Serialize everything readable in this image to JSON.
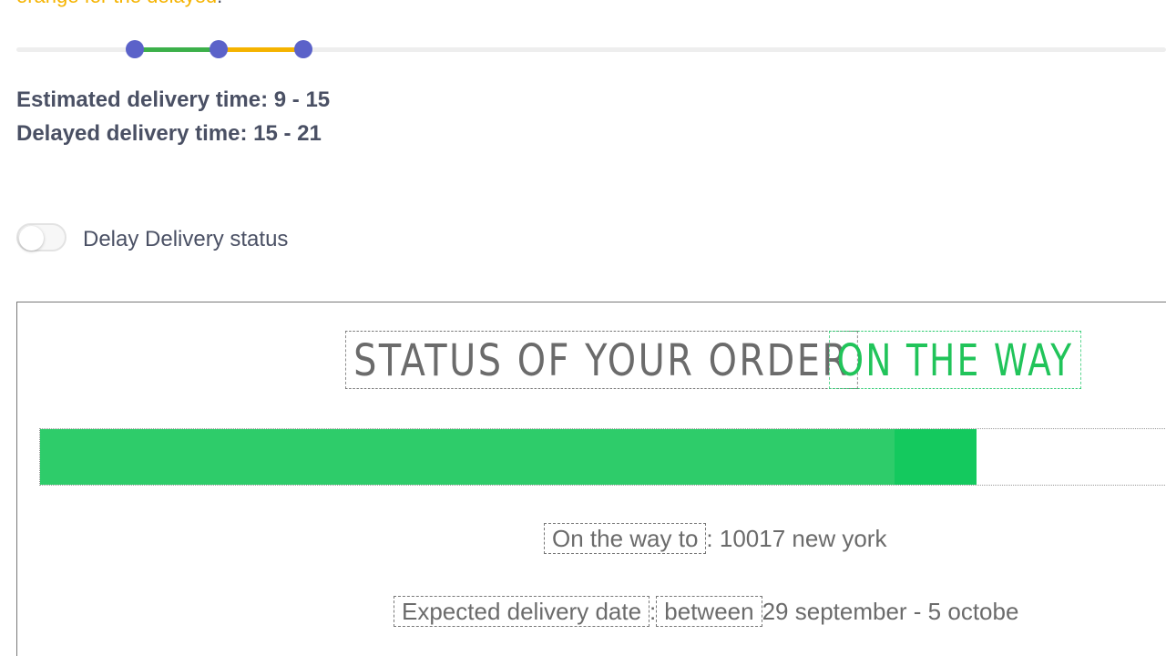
{
  "intro": {
    "orange_text": "orange for the delayed",
    "suffix": "."
  },
  "range_slider": {
    "estimated_range": [
      9,
      15
    ],
    "delayed_range": [
      15,
      21
    ],
    "colors": {
      "estimated": "#3cb04a",
      "delayed": "#f5b300",
      "knob": "#5b62c9"
    }
  },
  "delivery": {
    "estimated_label": "Estimated delivery time: 9 - 15",
    "delayed_label": "Delayed delivery time: 15 - 21"
  },
  "toggle": {
    "label": "Delay Delivery status",
    "checked": false
  },
  "preview": {
    "status_title": "STATUS OF YOUR ORDER",
    "status_value": "ON THE WAY",
    "status_color": "#21c45a",
    "progress_percent": 83,
    "way_label": "On the way to",
    "way_separator": ":",
    "way_value": "10017 new york",
    "date_label": "Expected delivery date",
    "date_separator": ":",
    "date_between": "between",
    "date_value": "29 september - 5 octobe"
  }
}
